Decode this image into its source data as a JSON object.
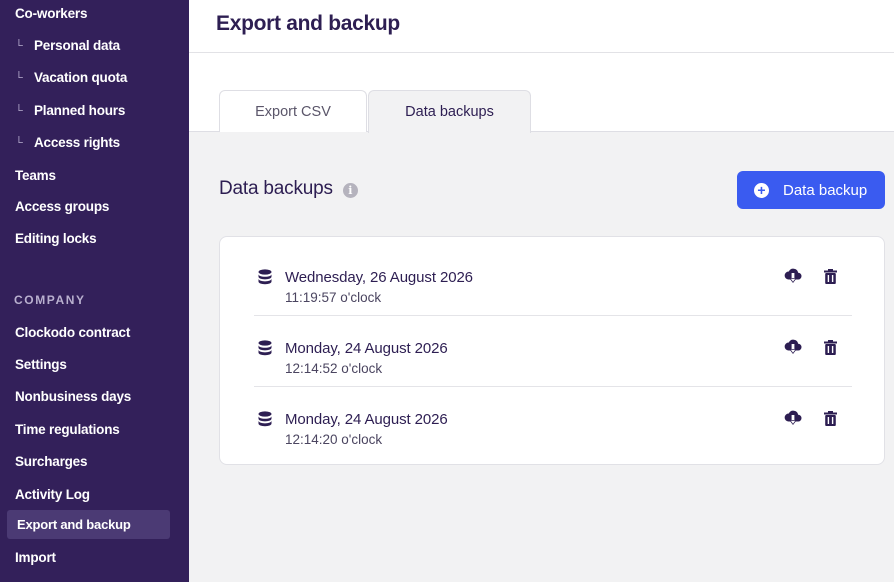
{
  "sidebar": {
    "items": [
      {
        "label": "Co-workers"
      },
      {
        "label": "Personal data",
        "sub": true
      },
      {
        "label": "Vacation quota",
        "sub": true
      },
      {
        "label": "Planned hours",
        "sub": true
      },
      {
        "label": "Access rights",
        "sub": true
      },
      {
        "label": "Teams"
      },
      {
        "label": "Access groups"
      },
      {
        "label": "Editing locks"
      }
    ],
    "section_heading": "COMPANY",
    "company_items": [
      {
        "label": "Clockodo contract"
      },
      {
        "label": "Settings"
      },
      {
        "label": "Nonbusiness days"
      },
      {
        "label": "Time regulations"
      },
      {
        "label": "Surcharges"
      },
      {
        "label": "Activity Log"
      },
      {
        "label": "Export and backup",
        "active": true
      },
      {
        "label": "Import"
      }
    ],
    "sub_glyph": "└"
  },
  "header": {
    "title": "Export and backup"
  },
  "tabs": [
    {
      "label": "Export CSV",
      "selected": false
    },
    {
      "label": "Data backups",
      "selected": true
    }
  ],
  "section": {
    "title": "Data backups",
    "info_icon": "info-icon",
    "button_label": "Data backup",
    "button_icon": "plus-circle-icon"
  },
  "backups": [
    {
      "date": "Wednesday, 26 August 2026",
      "time": "11:19:57 o'clock"
    },
    {
      "date": "Monday, 24 August 2026",
      "time": "12:14:52 o'clock"
    },
    {
      "date": "Monday, 24 August 2026",
      "time": "12:14:20 o'clock"
    }
  ],
  "colors": {
    "sidebar_bg": "#33205a",
    "accent": "#3a5bf0",
    "text_dark": "#2d1e52"
  }
}
